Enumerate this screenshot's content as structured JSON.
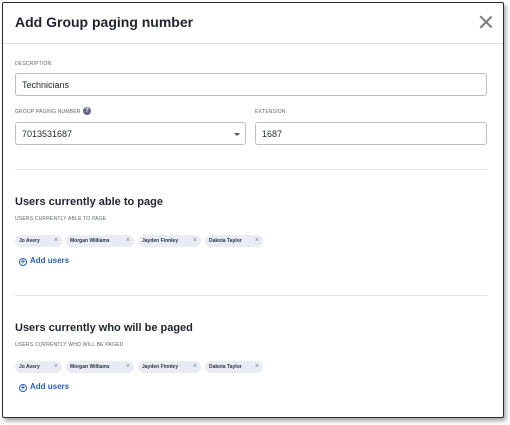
{
  "dialog": {
    "title": "Add Group paging number"
  },
  "description": {
    "label": "DESCRIPTION",
    "value": "Technicians"
  },
  "group_number": {
    "label": "GROUP PAGING NUMBER",
    "help_icon": "?",
    "value": "7013531687"
  },
  "extension": {
    "label": "EXTENSION",
    "value": "1687"
  },
  "section_page": {
    "title": "Users currently able to page",
    "sublabel": "USERS CURRENTLY ABLE TO PAGE",
    "chips": [
      "Jo Avery",
      "Morgan Williams",
      "Jayden Finnley",
      "Dakota Taylor"
    ],
    "add_label": "Add users"
  },
  "section_paged": {
    "title": "Users currently who will be paged",
    "sublabel": "USERS CURRENTLY WHO WILL BE PAGED",
    "chips": [
      "Jo Avery",
      "Morgan Williams",
      "Jayden Finnley",
      "Dakota Taylor"
    ],
    "add_label": "Add users"
  },
  "chip_remove_glyph": "×",
  "colors": {
    "link": "#2b5fb5",
    "chip_bg": "#e9edf3"
  }
}
